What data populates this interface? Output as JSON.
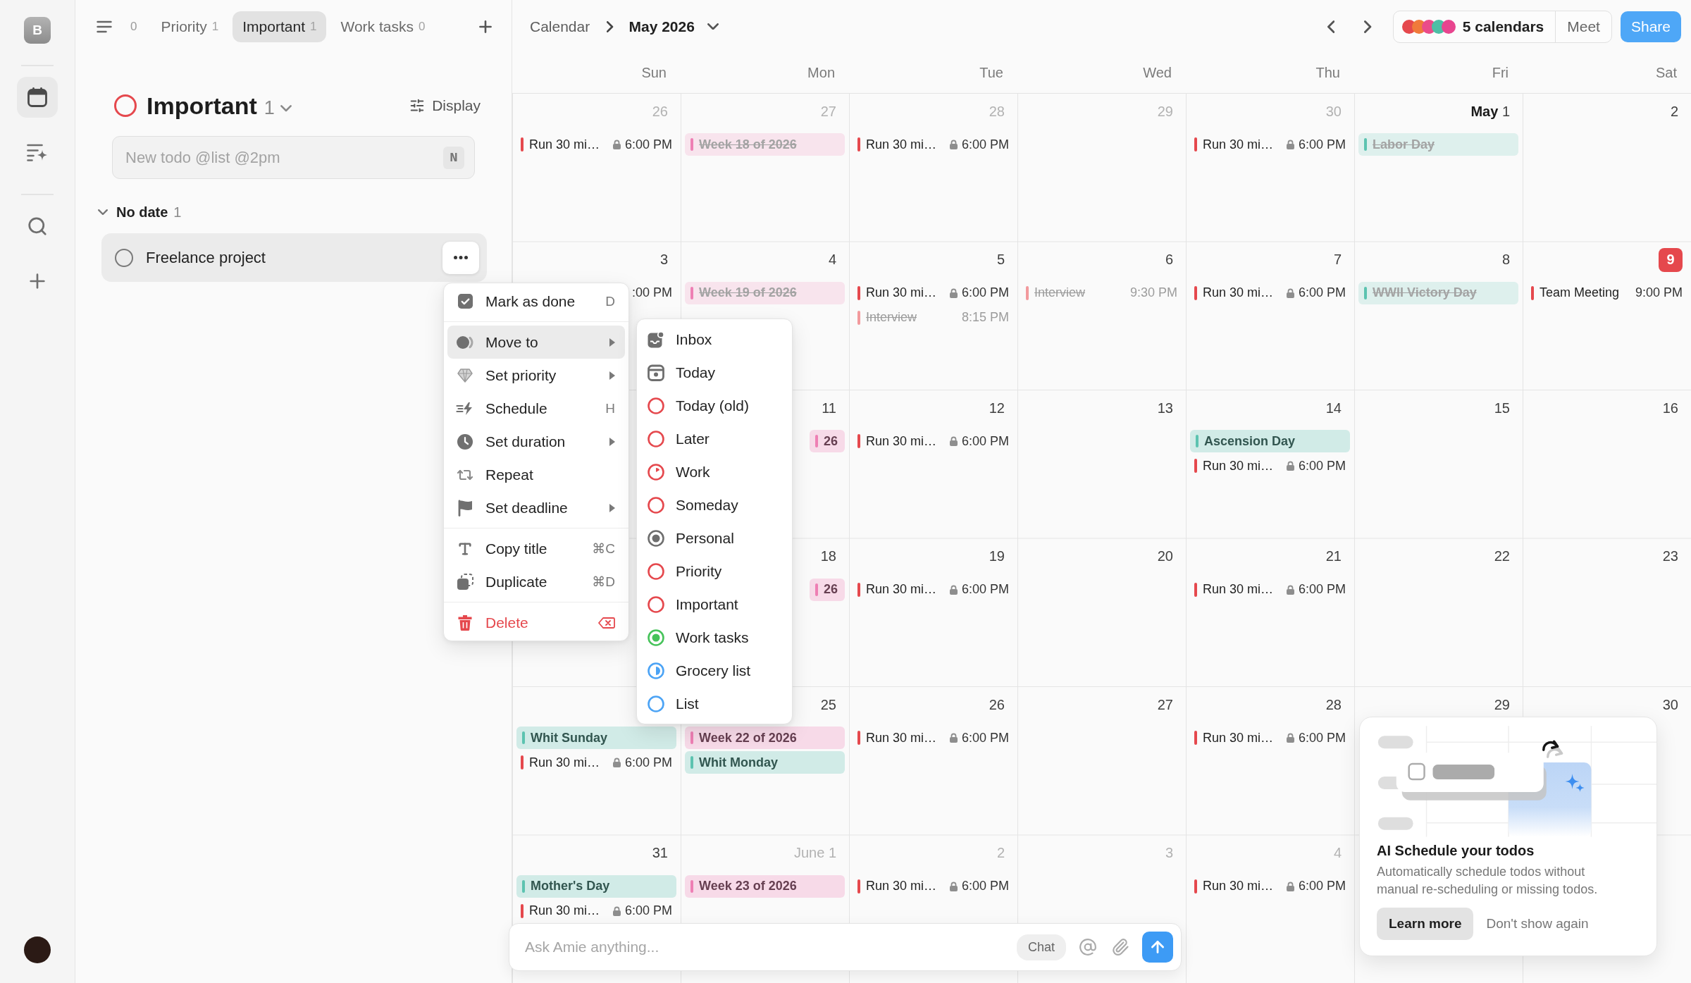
{
  "rail": {
    "workspace_initial": "B",
    "groups": [
      [
        {
          "kind": "calendar",
          "selected": true
        },
        {
          "kind": "ai_list",
          "selected": false
        }
      ],
      [
        {
          "kind": "search",
          "selected": false
        },
        {
          "kind": "add",
          "selected": false
        }
      ]
    ]
  },
  "list_tabs": [
    {
      "count": "0",
      "selected": false
    },
    {
      "label": "Priority",
      "count": "1",
      "selected": false
    },
    {
      "label": "Important",
      "count": "1",
      "selected": true
    },
    {
      "label": "Work tasks",
      "count": "0",
      "selected": false
    }
  ],
  "todo_panel": {
    "title": "Important",
    "count": "1",
    "display_label": "Display",
    "new_todo": {
      "placeholder": "New todo @list @2pm",
      "shortcut": "N"
    },
    "sections": [
      {
        "title": "No date",
        "count": "1",
        "expanded": true,
        "todos": [
          {
            "title": "Freelance project",
            "checked": false,
            "selected": true
          }
        ]
      }
    ]
  },
  "context_menu": {
    "groups": [
      [
        {
          "label": "Mark as done",
          "kind": "check",
          "shortcut": "D",
          "submenu": false,
          "selected": false
        }
      ],
      [
        {
          "label": "Move to",
          "kind": "move",
          "submenu": true,
          "selected": true
        },
        {
          "label": "Set priority",
          "kind": "priority",
          "submenu": true,
          "selected": false
        },
        {
          "label": "Schedule",
          "kind": "schedule",
          "shortcut": "H",
          "submenu": false,
          "selected": false
        },
        {
          "label": "Set duration",
          "kind": "duration",
          "submenu": true,
          "selected": false
        },
        {
          "label": "Repeat",
          "kind": "repeat",
          "submenu": false,
          "selected": false
        },
        {
          "label": "Set deadline",
          "kind": "deadline",
          "submenu": true,
          "selected": false
        }
      ],
      [
        {
          "label": "Copy title",
          "kind": "copy_title",
          "shortcut": "⌘C",
          "submenu": false,
          "selected": false
        },
        {
          "label": "Duplicate",
          "kind": "duplicate",
          "shortcut": "⌘D",
          "submenu": false,
          "selected": false
        }
      ],
      [
        {
          "label": "Delete",
          "kind": "delete",
          "submenu": false,
          "selected": false
        }
      ]
    ]
  },
  "move_to_menu": {
    "items": [
      {
        "label": "Inbox",
        "kind": "inbox",
        "color": "#6e6e6e"
      },
      {
        "label": "Today",
        "kind": "today",
        "color": "#6e6e6e"
      },
      {
        "label": "Today (old)",
        "kind": "ring",
        "color": "#e5484d"
      },
      {
        "label": "Later",
        "kind": "ring",
        "color": "#e5484d"
      },
      {
        "label": "Work",
        "kind": "clock",
        "color": "#e5484d"
      },
      {
        "label": "Someday",
        "kind": "ring",
        "color": "#e5484d"
      },
      {
        "label": "Personal",
        "kind": "dot",
        "color": "#6e6e6e"
      },
      {
        "label": "Priority",
        "kind": "ring",
        "color": "#e5484d"
      },
      {
        "label": "Important",
        "kind": "ring",
        "color": "#e5484d"
      },
      {
        "label": "Work tasks",
        "kind": "dot",
        "color": "#46c35a"
      },
      {
        "label": "Grocery list",
        "kind": "half",
        "color": "#4ba3f5"
      },
      {
        "label": "List",
        "kind": "ring",
        "color": "#4ba3f5"
      }
    ]
  },
  "calendar": {
    "breadcrumb": "Calendar",
    "month": "May 2026",
    "calendars": {
      "label": "5 calendars",
      "dots": [
        {
          "color": "#e5484d"
        },
        {
          "color": "#f07a3a"
        },
        {
          "color": "#ea4c89"
        },
        {
          "color": "#4dbfa5"
        },
        {
          "color": "#e8458f"
        }
      ]
    },
    "meet_label": "Meet",
    "share_label": "Share",
    "weekdays": [
      "Sun",
      "Mon",
      "Tue",
      "Wed",
      "Thu",
      "Fri",
      "Sat"
    ],
    "weeks": [
      {
        "days": [
          {
            "label": "26",
            "outside": true,
            "today": false,
            "events": [
              {
                "kind": "task",
                "title": "Run 30 mi…",
                "locked": true,
                "time": "6:00 PM",
                "color": "#e5484d",
                "done": false
              }
            ]
          },
          {
            "label": "27",
            "outside": true,
            "today": false,
            "events": [
              {
                "kind": "chip",
                "title": "Week 18 of 2026",
                "color": "#ee7fb4",
                "done": true
              }
            ]
          },
          {
            "label": "28",
            "outside": true,
            "today": false,
            "events": [
              {
                "kind": "task",
                "title": "Run 30 mi…",
                "locked": true,
                "time": "6:00 PM",
                "color": "#e5484d",
                "done": false
              }
            ]
          },
          {
            "label": "29",
            "outside": true,
            "today": false
          },
          {
            "label": "30",
            "outside": true,
            "today": false,
            "events": [
              {
                "kind": "task",
                "title": "Run 30 mi…",
                "locked": true,
                "time": "6:00 PM",
                "color": "#e5484d",
                "done": false
              }
            ]
          },
          {
            "month": "May",
            "label": "1",
            "outside": false,
            "today": false,
            "events": [
              {
                "kind": "chip",
                "title": "Labor Day",
                "color": "#5cc3b0",
                "done": true
              }
            ]
          },
          {
            "label": "2",
            "outside": false,
            "today": false
          }
        ]
      },
      {
        "days": [
          {
            "label": "3",
            "outside": false,
            "today": false,
            "events": [
              {
                "kind": "task",
                "locked": false,
                "time": ":00 PM",
                "done": false,
                "partial": true
              }
            ]
          },
          {
            "label": "4",
            "outside": false,
            "today": false,
            "events": [
              {
                "kind": "chip",
                "title": "Week 19 of 2026",
                "color": "#ee7fb4",
                "done": true
              }
            ]
          },
          {
            "label": "5",
            "outside": false,
            "today": false,
            "events": [
              {
                "kind": "task",
                "title": "Run 30 mi…",
                "locked": true,
                "time": "6:00 PM",
                "color": "#e5484d",
                "done": false
              },
              {
                "kind": "task",
                "title": "Interview",
                "locked": false,
                "time": "8:15 PM",
                "color": "#f29a9d",
                "done": true
              }
            ]
          },
          {
            "label": "6",
            "outside": false,
            "today": false,
            "events": [
              {
                "kind": "task",
                "title": "Interview",
                "locked": false,
                "time": "9:30 PM",
                "color": "#f29a9d",
                "done": true
              }
            ]
          },
          {
            "label": "7",
            "outside": false,
            "today": false,
            "events": [
              {
                "kind": "task",
                "title": "Run 30 mi…",
                "locked": true,
                "time": "6:00 PM",
                "color": "#e5484d",
                "done": false
              }
            ]
          },
          {
            "label": "8",
            "outside": false,
            "today": false,
            "events": [
              {
                "kind": "chip",
                "title": "WWII Victory Day",
                "color": "#5cc3b0",
                "done": true
              }
            ]
          },
          {
            "label": "9",
            "outside": false,
            "today": true,
            "events": [
              {
                "kind": "task",
                "title": "Team Meeting",
                "locked": false,
                "time": "9:00 PM",
                "color": "#e5484d",
                "done": false
              }
            ]
          }
        ]
      },
      {
        "days": [
          {
            "label": "11",
            "outside": false,
            "today": false,
            "events": [
              {
                "kind": "chip",
                "title": "26",
                "color": "#ee7fb4",
                "done": false,
                "partial": true
              }
            ]
          },
          {
            "label": "12",
            "outside": false,
            "today": false,
            "events": [
              {
                "kind": "task",
                "title": "Run 30 mi…",
                "locked": true,
                "time": "6:00 PM",
                "color": "#e5484d",
                "done": false
              }
            ]
          },
          {
            "label": "13",
            "outside": false,
            "today": false
          },
          {
            "label": "14",
            "outside": false,
            "today": false,
            "events": [
              {
                "kind": "chip",
                "title": "Ascension Day",
                "color": "#5cc3b0",
                "done": false
              },
              {
                "kind": "task",
                "title": "Run 30 mi…",
                "locked": true,
                "time": "6:00 PM",
                "color": "#e5484d",
                "done": false
              }
            ]
          },
          {
            "label": "15",
            "outside": false,
            "today": false
          },
          {
            "label": "16",
            "outside": false,
            "today": false
          }
        ]
      },
      {
        "days": [
          {
            "label": "18",
            "outside": false,
            "today": false,
            "events": [
              {
                "kind": "chip",
                "title": "26",
                "color": "#ee7fb4",
                "done": false,
                "partial": true
              }
            ]
          },
          {
            "label": "19",
            "outside": false,
            "today": false,
            "events": [
              {
                "kind": "task",
                "title": "Run 30 mi…",
                "locked": true,
                "time": "6:00 PM",
                "color": "#e5484d",
                "done": false
              }
            ]
          },
          {
            "label": "20",
            "outside": false,
            "today": false
          },
          {
            "label": "21",
            "outside": false,
            "today": false,
            "events": [
              {
                "kind": "task",
                "title": "Run 30 mi…",
                "locked": true,
                "time": "6:00 PM",
                "color": "#e5484d",
                "done": false
              }
            ]
          },
          {
            "label": "22",
            "outside": false,
            "today": false
          },
          {
            "label": "23",
            "outside": false,
            "today": false
          }
        ]
      },
      {
        "days": [
          {
            "events": [
              {
                "kind": "chip",
                "title": "Whit Sunday",
                "color": "#5cc3b0",
                "done": false
              },
              {
                "kind": "task",
                "title": "Run 30 mi…",
                "locked": true,
                "time": "6:00 PM",
                "color": "#e5484d",
                "done": false
              }
            ]
          },
          {
            "label": "25",
            "outside": false,
            "today": false,
            "events": [
              {
                "kind": "chip",
                "title": "Week 22 of 2026",
                "color": "#ee7fb4",
                "done": false
              },
              {
                "kind": "chip",
                "title": "Whit Monday",
                "color": "#5cc3b0",
                "done": false
              }
            ]
          },
          {
            "label": "26",
            "outside": false,
            "today": false,
            "events": [
              {
                "kind": "task",
                "title": "Run 30 mi…",
                "locked": true,
                "time": "6:00 PM",
                "color": "#e5484d",
                "done": false
              }
            ]
          },
          {
            "label": "27",
            "outside": false,
            "today": false
          },
          {
            "label": "28",
            "outside": false,
            "today": false,
            "events": [
              {
                "kind": "task",
                "title": "Run 30 mi…",
                "locked": true,
                "time": "6:00 PM",
                "color": "#e5484d",
                "done": false
              }
            ]
          },
          {
            "label": "29",
            "outside": false,
            "today": false
          },
          {
            "label": "30",
            "outside": false,
            "today": false
          }
        ]
      },
      {
        "days": [
          {
            "label": "31",
            "outside": false,
            "today": false,
            "events": [
              {
                "kind": "chip",
                "title": "Mother's Day",
                "color": "#5cc3b0",
                "done": false
              },
              {
                "kind": "task",
                "title": "Run 30 mi…",
                "locked": true,
                "time": "6:00 PM",
                "color": "#e5484d",
                "done": false
              }
            ]
          },
          {
            "month": "June",
            "label": "1",
            "outside": true,
            "today": false,
            "events": [
              {
                "kind": "chip",
                "title": "Week 23 of 2026",
                "color": "#ee7fb4",
                "done": false
              }
            ]
          },
          {
            "label": "2",
            "outside": true,
            "today": false,
            "events": [
              {
                "kind": "task",
                "title": "Run 30 mi…",
                "locked": true,
                "time": "6:00 PM",
                "color": "#e5484d",
                "done": false
              }
            ]
          },
          {
            "label": "3",
            "outside": true,
            "today": false
          },
          {
            "label": "4",
            "outside": true,
            "today": false,
            "events": [
              {
                "kind": "task",
                "title": "Run 30 mi…",
                "locked": true,
                "time": "6:00 PM",
                "color": "#e5484d",
                "done": false
              }
            ]
          }
        ]
      }
    ]
  },
  "chat": {
    "placeholder": "Ask Amie anything...",
    "mode_label": "Chat"
  },
  "ai_popup": {
    "title": "AI Schedule your todos",
    "description": "Automatically schedule todos without manual re-scheduling or missing todos.",
    "primary_label": "Learn more",
    "secondary_label": "Don't show again"
  }
}
